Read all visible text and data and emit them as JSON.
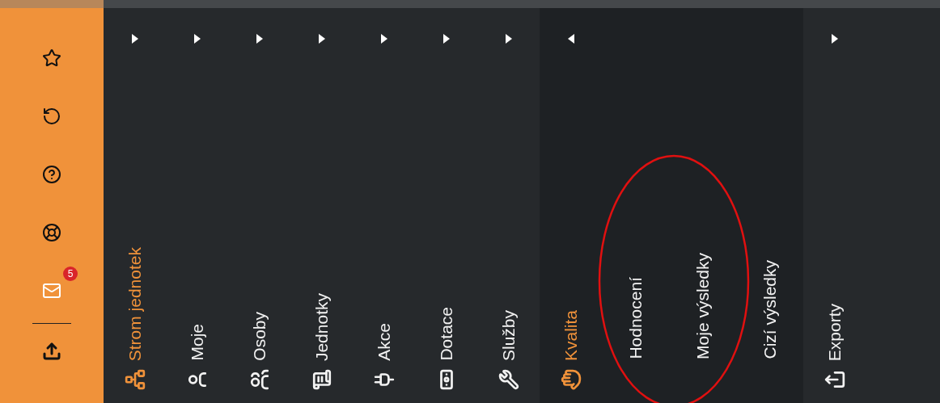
{
  "rail": {
    "mail_badge": "5"
  },
  "menu": {
    "items": [
      {
        "label": "Strom jednotek",
        "selected": true,
        "expanded": false
      },
      {
        "label": "Moje",
        "selected": false,
        "expanded": false
      },
      {
        "label": "Osoby",
        "selected": false,
        "expanded": false
      },
      {
        "label": "Jednotky",
        "selected": false,
        "expanded": false
      },
      {
        "label": "Akce",
        "selected": false,
        "expanded": false
      },
      {
        "label": "Dotace",
        "selected": false,
        "expanded": false
      },
      {
        "label": "Služby",
        "selected": false,
        "expanded": false
      },
      {
        "label": "Kvalita",
        "selected": true,
        "expanded": true,
        "children": [
          {
            "label": "Hodnocení"
          },
          {
            "label": "Moje výsledky"
          },
          {
            "label": "Cizí výsledky"
          }
        ]
      },
      {
        "label": "Exporty",
        "selected": false,
        "expanded": false
      }
    ]
  }
}
